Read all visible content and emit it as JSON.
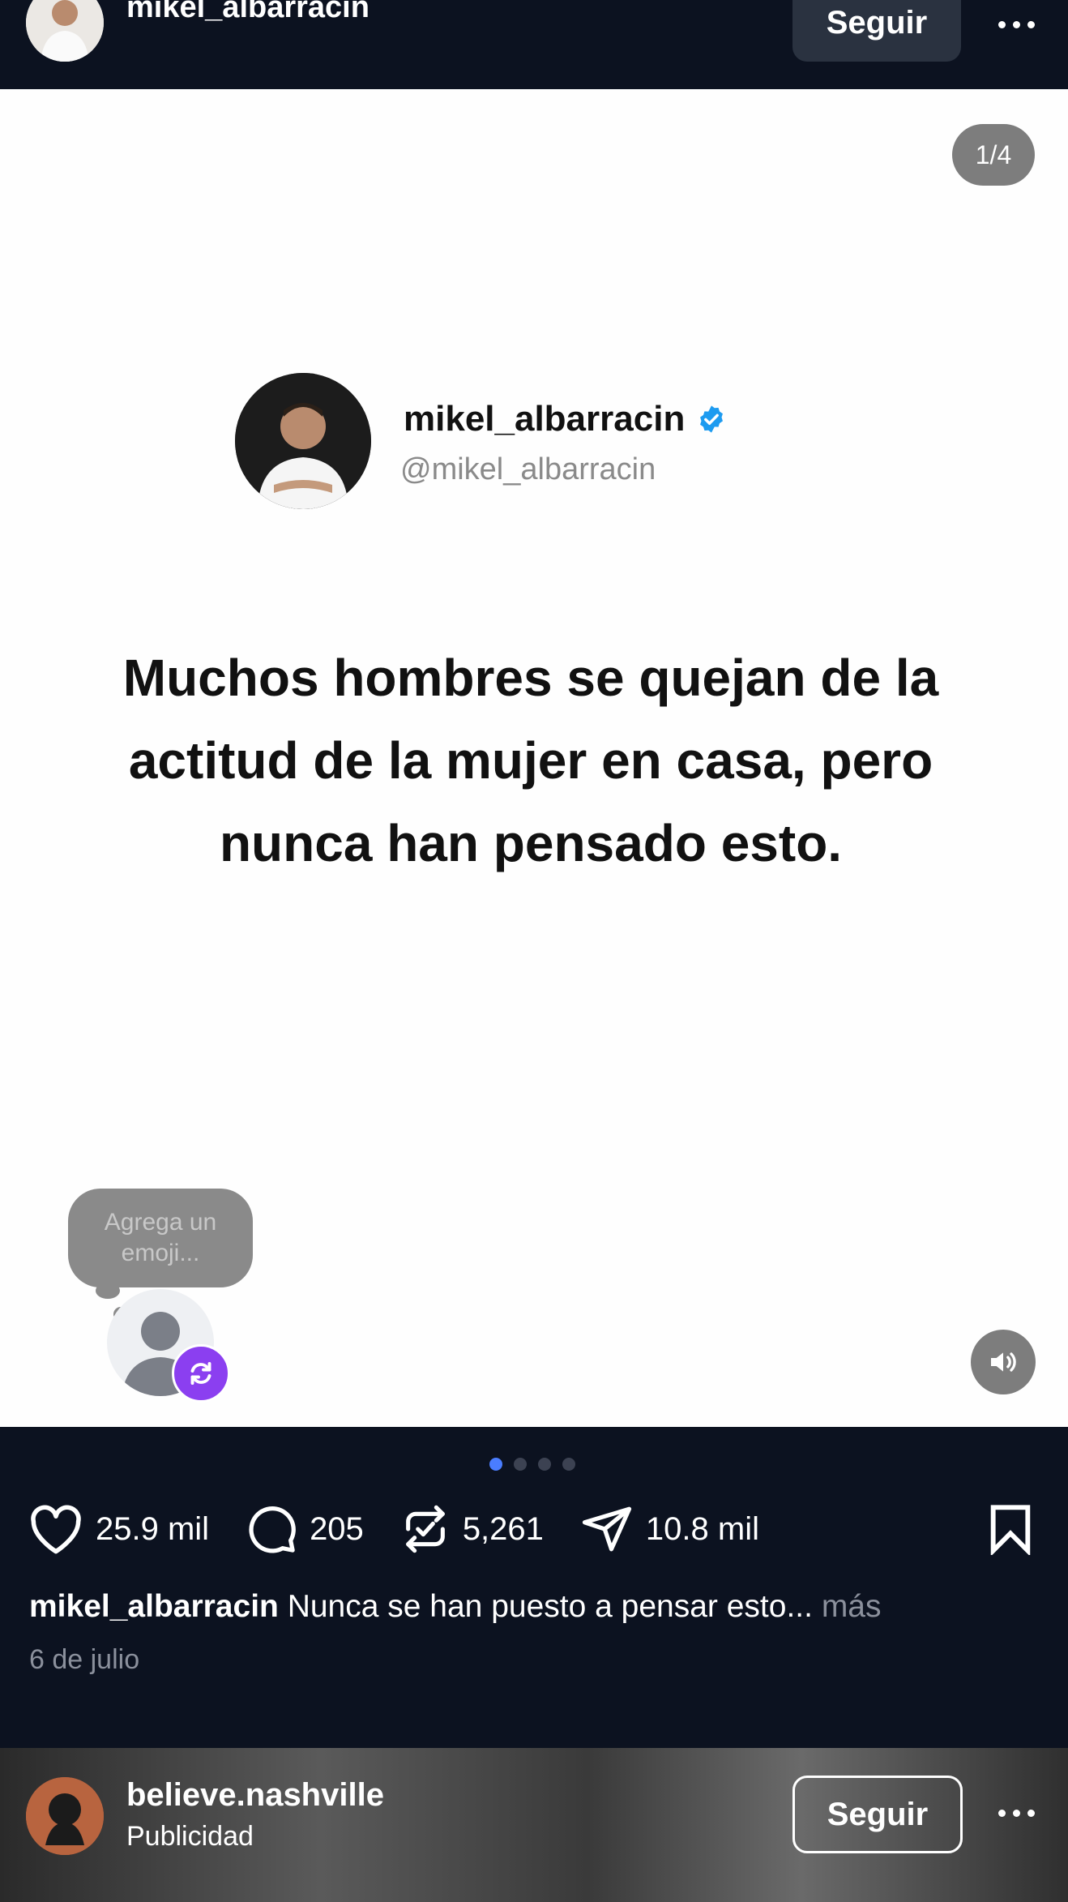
{
  "header": {
    "username": "mikel_albarracin",
    "follow_label": "Seguir"
  },
  "post": {
    "slide_counter": "1/4",
    "card": {
      "name": "mikel_albarracin",
      "handle": "@mikel_albarracin"
    },
    "quote": "Muchos hombres se quejan de la actitud de la mujer en casa, pero nunca han pensado esto.",
    "emoji_prompt": "Agrega un emoji...",
    "pager": {
      "total": 4,
      "active": 0
    }
  },
  "actions": {
    "likes": "25.9 mil",
    "comments": "205",
    "reposts": "5,261",
    "shares": "10.8 mil"
  },
  "caption": {
    "username": "mikel_albarracin",
    "text": "Nunca se han puesto a pensar esto...",
    "more": "más",
    "date": "6 de julio"
  },
  "next_post": {
    "username": "believe.nashville",
    "subtitle": "Publicidad",
    "follow_label": "Seguir"
  },
  "colors": {
    "background": "#0c1220",
    "accent": "#4a7dff",
    "verified": "#1d9bf0",
    "swap_badge": "#8b3ff0"
  }
}
